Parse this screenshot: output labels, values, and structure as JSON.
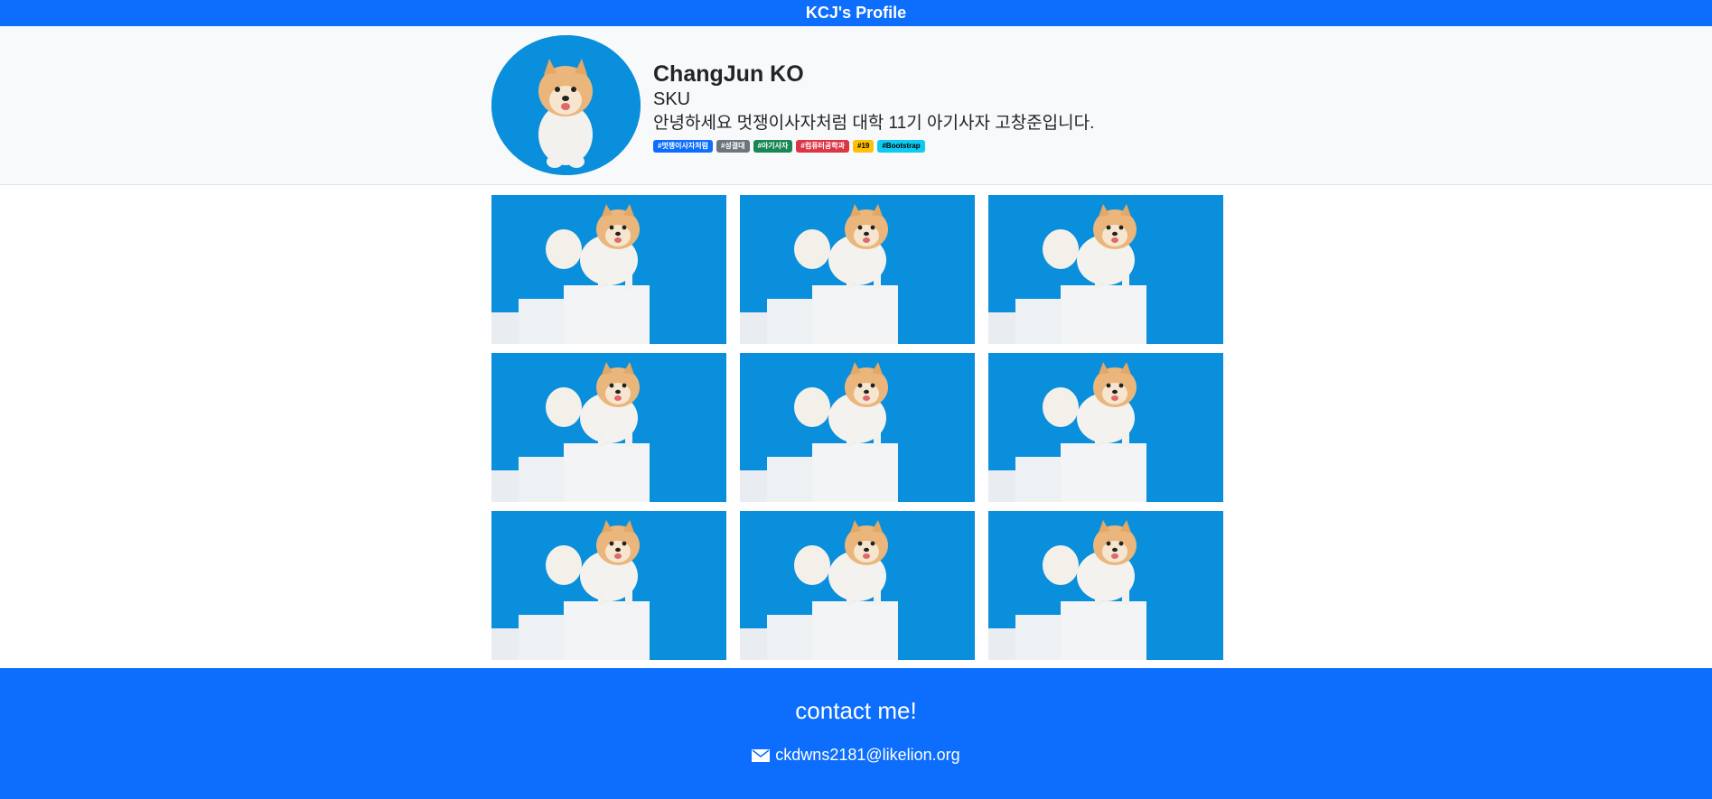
{
  "header": {
    "title": "KCJ's Profile"
  },
  "profile": {
    "avatar_icon": "pomeranian-dog-photo",
    "name": "ChangJun KO",
    "org": "SKU",
    "bio": "안녕하세요 멋쟁이사자처럼 대학 11기 아기사자 고창준입니다.",
    "tags": [
      {
        "label": "#멋쟁이사자처럼",
        "color": "#0d6efd"
      },
      {
        "label": "#성결대",
        "color": "#6c757d"
      },
      {
        "label": "#아기사자",
        "color": "#198754"
      },
      {
        "label": "#컴퓨터공학과",
        "color": "#dc3545"
      },
      {
        "label": "#19",
        "color": "#ffc107"
      },
      {
        "label": "#Bootstrap",
        "color": "#0dcaf0"
      }
    ]
  },
  "gallery": {
    "photo_icon": "pomeranian-dog-photo",
    "count": 9
  },
  "footer": {
    "title": "contact me!",
    "email_icon": "envelope-icon",
    "email": "ckdwns2181@likelion.org"
  }
}
